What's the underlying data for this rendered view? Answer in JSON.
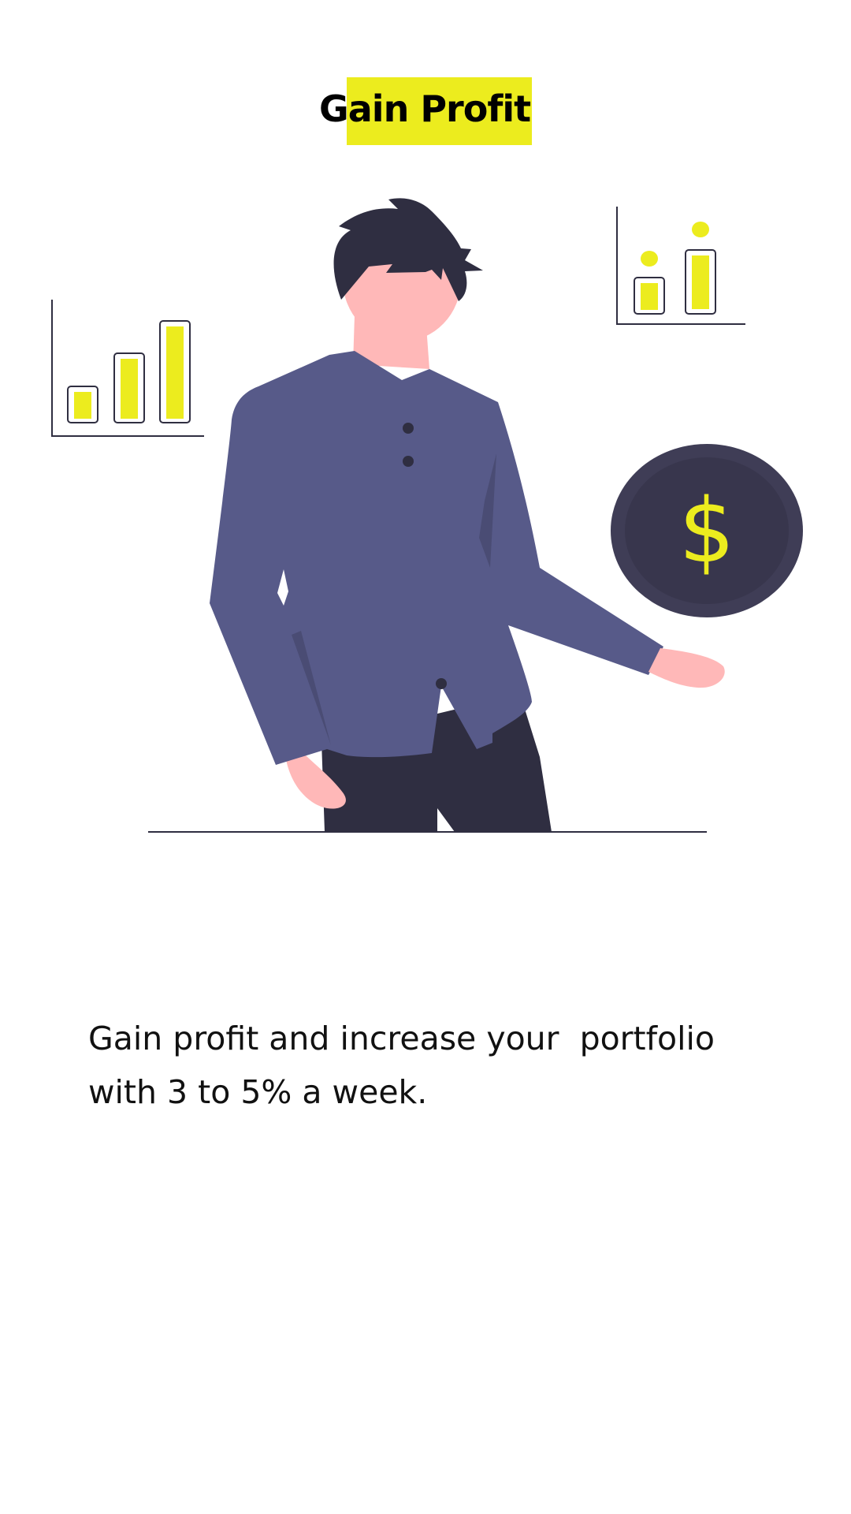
{
  "header": {
    "title": "Gain Profit",
    "highlight_color": "#ecec1e"
  },
  "illustration": {
    "coin_symbol": "$",
    "accent_color": "#ecec1e",
    "shirt_color": "#575a89",
    "dark_color": "#2f2e41",
    "skin_color": "#ffb8b8",
    "icons": [
      "bar-chart-icon-left",
      "bar-chart-icon-right",
      "dollar-coin-icon",
      "person-illustration"
    ]
  },
  "description": {
    "text": "Gain profit and increase your  portfolio\nwith 3 to 5% a week."
  }
}
